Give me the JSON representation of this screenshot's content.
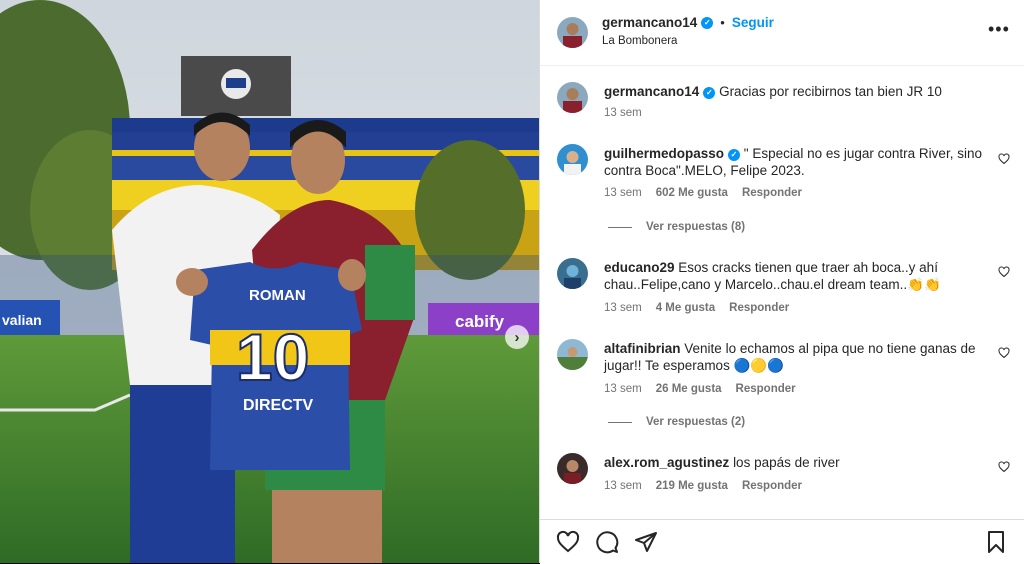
{
  "header": {
    "username": "germancano14",
    "separator": "•",
    "follow_label": "Seguir",
    "location": "La Bombonera",
    "more_icon": "more-icon"
  },
  "caption": {
    "username": "germancano14",
    "text": "Gracias por recibirnos tan bien JR 10",
    "time": "13 sem"
  },
  "comments": [
    {
      "username": "guilhermedopasso",
      "verified": true,
      "text": "\" Especial no es jugar contra River, sino contra Boca\".MELO, Felipe 2023.",
      "time": "13 sem",
      "likes": "602 Me gusta",
      "reply": "Responder",
      "view_replies": "Ver respuestas (8)"
    },
    {
      "username": "educano29",
      "verified": false,
      "text": "Esos cracks tienen que traer ah boca..y ahí chau..Felipe,cano y Marcelo..chau.el dream team..👏👏",
      "time": "13 sem",
      "likes": "4 Me gusta",
      "reply": "Responder",
      "view_replies": ""
    },
    {
      "username": "altafinibrian",
      "verified": false,
      "text": "Venite lo echamos al pipa que no tiene ganas de jugar!! Te esperamos 🔵🟡🔵",
      "time": "13 sem",
      "likes": "26 Me gusta",
      "reply": "Responder",
      "view_replies": "Ver respuestas (2)"
    },
    {
      "username": "alex.rom_agustinez",
      "verified": false,
      "text": "los papás de river",
      "time": "13 sem",
      "likes": "219 Me gusta",
      "reply": "Responder",
      "view_replies": ""
    }
  ],
  "photo": {
    "jersey_name": "ROMAN",
    "jersey_number": "10",
    "sponsor": "DIRECTV",
    "ad_board_right": "cabify",
    "ad_board_left": "valian"
  },
  "actions": [
    "like-icon",
    "comment-icon",
    "share-icon",
    "save-icon"
  ]
}
